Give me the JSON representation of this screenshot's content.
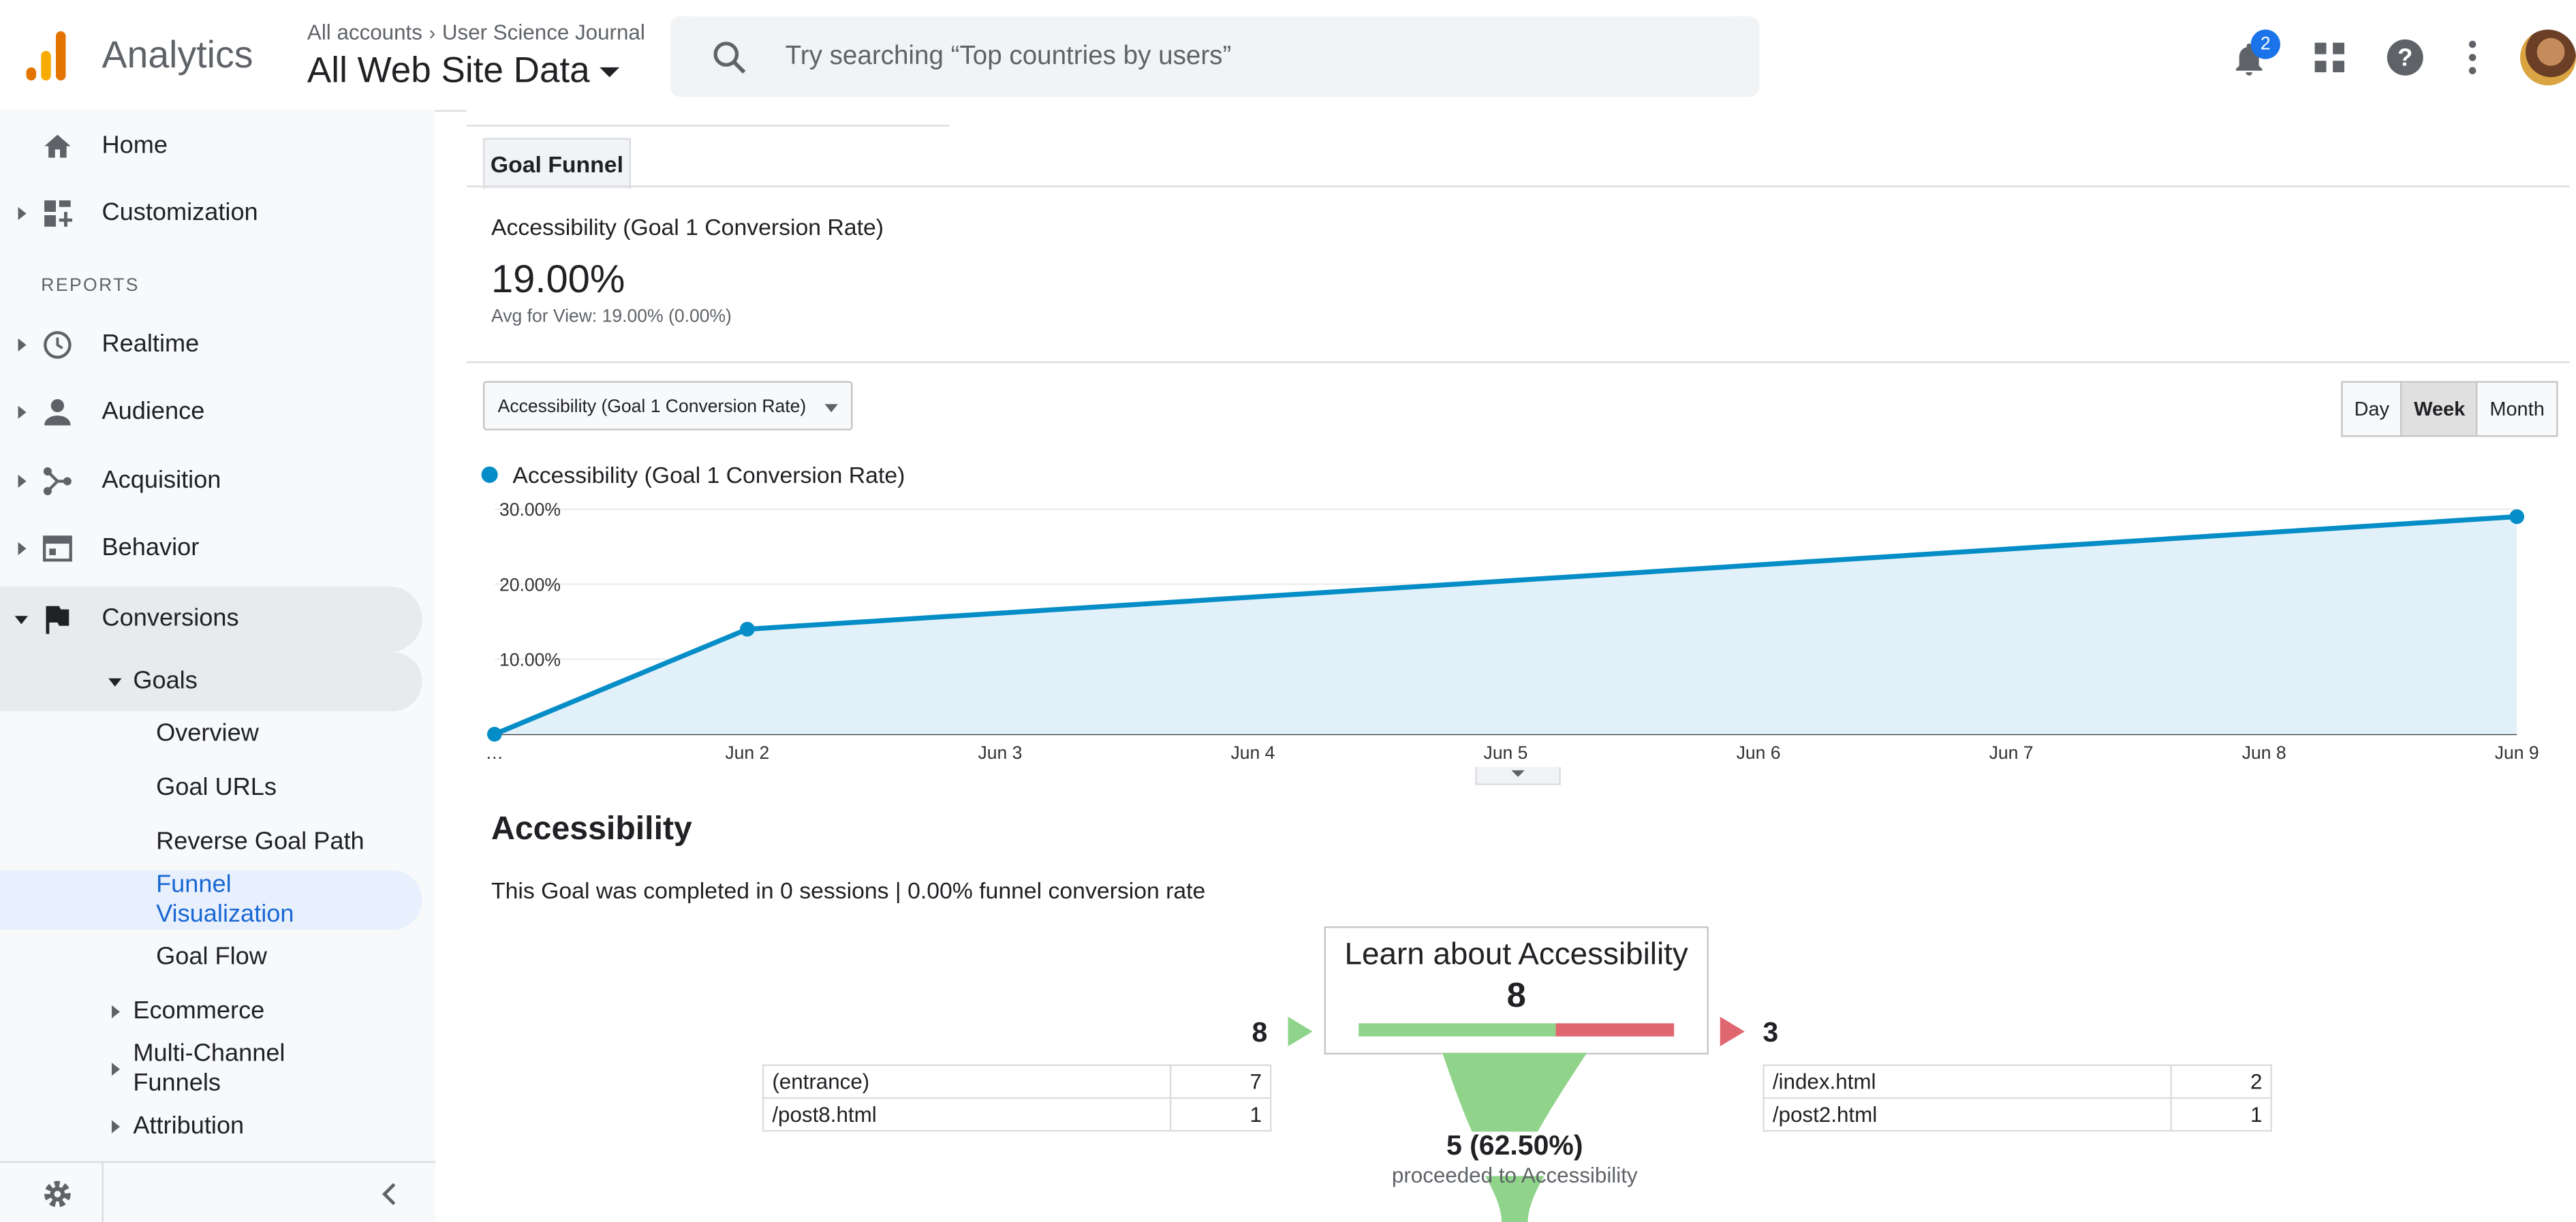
{
  "header": {
    "app_name": "Analytics",
    "breadcrumb": [
      "All accounts",
      "User Science Journal"
    ],
    "property": "All Web Site Data",
    "search_placeholder": "Try searching “Top countries by users”",
    "notification_count": "2",
    "icons": [
      "bell-icon",
      "apps-icon",
      "help-icon",
      "more-vert-icon"
    ]
  },
  "sidebar": {
    "home": "Home",
    "customization": "Customization",
    "section": "REPORTS",
    "realtime": "Realtime",
    "audience": "Audience",
    "acquisition": "Acquisition",
    "behavior": "Behavior",
    "conversions": "Conversions",
    "goals": "Goals",
    "goal_items": [
      "Overview",
      "Goal URLs",
      "Reverse Goal Path",
      "Funnel Visualization",
      "Goal Flow"
    ],
    "ecommerce": "Ecommerce",
    "multi_channel": "Multi-Channel Funnels",
    "attribution": "Attribution"
  },
  "main": {
    "tab": "Goal Funnel",
    "metric_name": "Accessibility (Goal 1 Conversion Rate)",
    "metric_value": "19.00%",
    "metric_avg": "Avg for View: 19.00% (0.00%)",
    "selector": "Accessibility (Goal 1 Conversion Rate)",
    "periods": [
      "Day",
      "Week",
      "Month"
    ],
    "active_period": "Week"
  },
  "chart_data": {
    "type": "area",
    "x": [
      "…",
      "Jun 2",
      "Jun 3",
      "Jun 4",
      "Jun 5",
      "Jun 6",
      "Jun 7",
      "Jun 8",
      "Jun 9"
    ],
    "series": [
      {
        "name": "Accessibility (Goal 1 Conversion Rate)",
        "points": [
          {
            "x": "…",
            "y": 0
          },
          {
            "x": "Jun 2",
            "y": 14
          },
          {
            "x": "Jun 9",
            "y": 29
          }
        ]
      }
    ],
    "y_ticks": [
      "30.00%",
      "20.00%",
      "10.00%"
    ],
    "ylim": [
      0,
      30
    ],
    "color": "#058dc7",
    "fill": "#e2f1f9",
    "grid": true,
    "legend": "top-left"
  },
  "funnel": {
    "title": "Accessibility",
    "summary": "This Goal was completed in 0 sessions | 0.00% funnel conversion rate",
    "step_name": "Learn about Accessibility",
    "step_count": "8",
    "entrances": "8",
    "exits": "3",
    "continued_fraction": 0.625,
    "entrance_sources": [
      {
        "page": "(entrance)",
        "count": "7"
      },
      {
        "page": "/post8.html",
        "count": "1"
      }
    ],
    "exit_pages": [
      {
        "page": "/index.html",
        "count": "2"
      },
      {
        "page": "/post2.html",
        "count": "1"
      }
    ],
    "proceeded": "5 (62.50%)",
    "proceeded_label": "proceeded to Accessibility",
    "colors": {
      "green": "#8fd48a",
      "red": "#e06670"
    }
  }
}
